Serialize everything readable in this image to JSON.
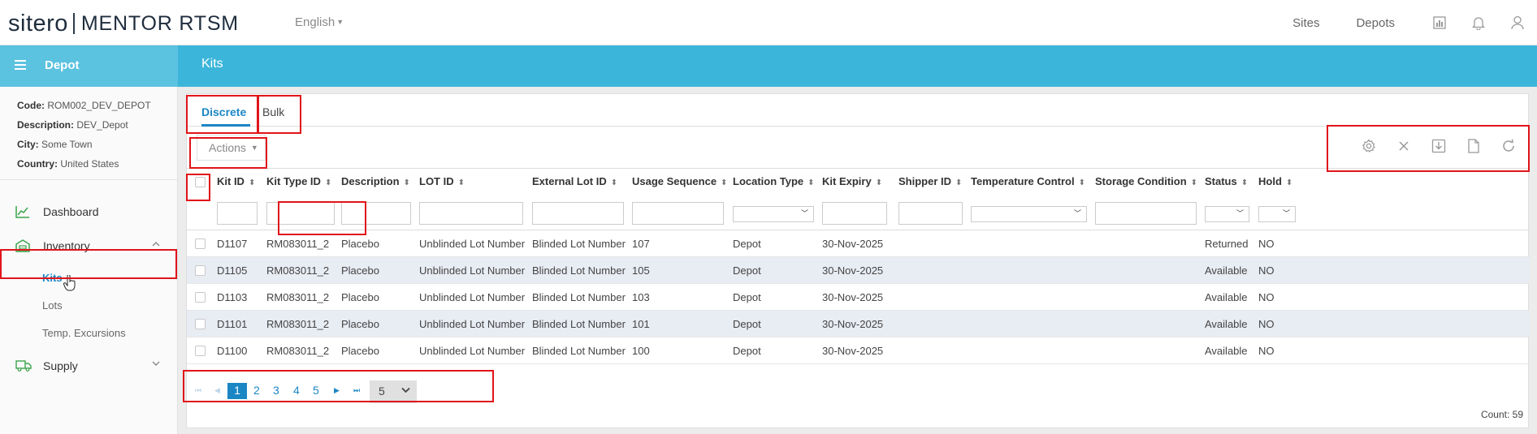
{
  "app": {
    "brand": "sitero",
    "product": "MENTOR RTSM",
    "language": "English",
    "nav": [
      "Sites",
      "Depots"
    ]
  },
  "sidebar": {
    "header": "Depot",
    "info": {
      "code_label": "Code:",
      "code": "ROM002_DEV_DEPOT",
      "description_label": "Description:",
      "description": "DEV_Depot",
      "city_label": "City:",
      "city": "Some Town",
      "country_label": "Country:",
      "country": "United States"
    },
    "menu": {
      "dashboard": "Dashboard",
      "inventory": "Inventory",
      "kits": "Kits",
      "lots": "Lots",
      "temp_excursions": "Temp. Excursions",
      "supply": "Supply"
    }
  },
  "page": {
    "title": "Kits",
    "tabs": [
      "Discrete",
      "Bulk"
    ],
    "actions_label": "Actions",
    "columns": [
      "Kit ID",
      "Kit Type ID",
      "Description",
      "LOT ID",
      "External Lot ID",
      "Usage Sequence",
      "Location Type",
      "Kit Expiry",
      "Shipper ID",
      "Temperature Control",
      "Storage Condition",
      "Status",
      "Hold"
    ],
    "rows": [
      [
        "D1107",
        "RM083011_2",
        "Placebo",
        "Unblinded Lot Number",
        "Blinded Lot Number",
        "107",
        "Depot",
        "30-Nov-2025",
        "",
        "",
        "",
        "Returned",
        "NO"
      ],
      [
        "D1105",
        "RM083011_2",
        "Placebo",
        "Unblinded Lot Number",
        "Blinded Lot Number",
        "105",
        "Depot",
        "30-Nov-2025",
        "",
        "",
        "",
        "Available",
        "NO"
      ],
      [
        "D1103",
        "RM083011_2",
        "Placebo",
        "Unblinded Lot Number",
        "Blinded Lot Number",
        "103",
        "Depot",
        "30-Nov-2025",
        "",
        "",
        "",
        "Available",
        "NO"
      ],
      [
        "D1101",
        "RM083011_2",
        "Placebo",
        "Unblinded Lot Number",
        "Blinded Lot Number",
        "101",
        "Depot",
        "30-Nov-2025",
        "",
        "",
        "",
        "Available",
        "NO"
      ],
      [
        "D1100",
        "RM083011_2",
        "Placebo",
        "Unblinded Lot Number",
        "Blinded Lot Number",
        "100",
        "Depot",
        "30-Nov-2025",
        "",
        "",
        "",
        "Available",
        "NO"
      ]
    ],
    "pager": {
      "pages": [
        "1",
        "2",
        "3",
        "4",
        "5"
      ],
      "current": "1",
      "page_size": "5"
    },
    "count": "Count: 59"
  },
  "colors": {
    "accent": "#1c86c4",
    "header_band": "#3bb6da",
    "sidebar_band": "#5bc2e0",
    "highlight_box": "#e0141a"
  }
}
